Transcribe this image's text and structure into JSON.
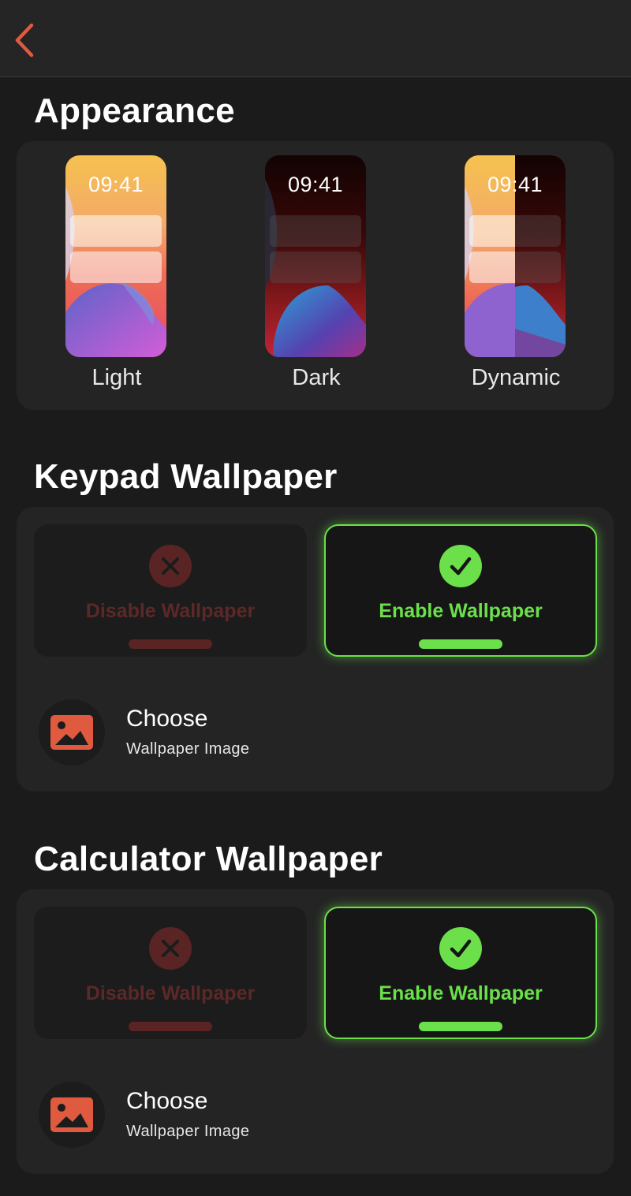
{
  "colors": {
    "accent": "#e05a40",
    "enable_green": "#6be04a",
    "disable_red": "#5a2424",
    "background": "#1b1b1b",
    "card": "#242424"
  },
  "navbar": {
    "back_icon": "chevron-left-icon"
  },
  "appearance": {
    "title": "Appearance",
    "options": [
      {
        "label": "Light",
        "time": "09:41",
        "selected": false
      },
      {
        "label": "Dark",
        "time": "09:41",
        "selected": false
      },
      {
        "label": "Dynamic",
        "time": "09:41",
        "selected": true
      }
    ]
  },
  "keypad": {
    "title": "Keypad Wallpaper",
    "disable_label": "Disable Wallpaper",
    "enable_label": "Enable Wallpaper",
    "enabled": true,
    "choose_title": "Choose",
    "choose_subtitle": "Wallpaper Image",
    "choose_icon": "image-icon"
  },
  "calculator": {
    "title": "Calculator Wallpaper",
    "disable_label": "Disable Wallpaper",
    "enable_label": "Enable Wallpaper",
    "enabled": true,
    "choose_title": "Choose",
    "choose_subtitle": "Wallpaper Image",
    "choose_icon": "image-icon"
  }
}
